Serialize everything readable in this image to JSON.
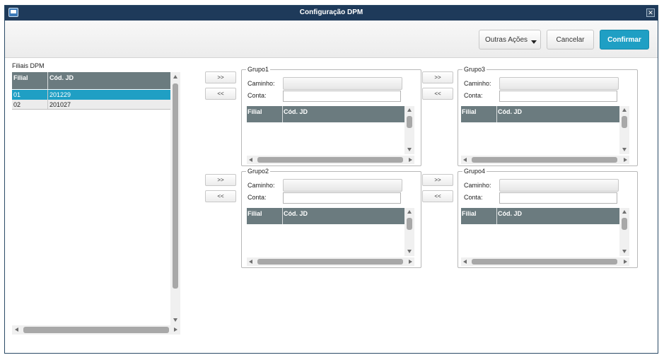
{
  "window": {
    "title": "Configuração DPM"
  },
  "toolbar": {
    "other_actions_label": "Outras Ações",
    "cancel_label": "Cancelar",
    "confirm_label": "Confirmar"
  },
  "filiais": {
    "label": "Filiais DPM",
    "columns": [
      "Filial",
      "Cód. JD"
    ],
    "rows": [
      {
        "filial": "01",
        "cod": "201229",
        "selected": true
      },
      {
        "filial": "02",
        "cod": "201027",
        "selected": false
      }
    ]
  },
  "move": {
    "add_label": ">>",
    "remove_label": "<<"
  },
  "groups": [
    {
      "title": "Grupo1",
      "caminho_label": "Caminho:",
      "conta_label": "Conta:",
      "conta_value": "",
      "columns": [
        "Filial",
        "Cód. JD"
      ]
    },
    {
      "title": "Grupo2",
      "caminho_label": "Caminho:",
      "conta_label": "Conta:",
      "conta_value": "",
      "columns": [
        "Filial",
        "Cód. JD"
      ]
    },
    {
      "title": "Grupo3",
      "caminho_label": "Caminho:",
      "conta_label": "Conta:",
      "conta_value": "",
      "columns": [
        "Filial",
        "Cód. JD"
      ]
    },
    {
      "title": "Grupo4",
      "caminho_label": "Caminho:",
      "conta_label": "Conta:",
      "conta_value": "",
      "columns": [
        "Filial",
        "Cód. JD"
      ]
    }
  ],
  "colors": {
    "titlebar": "#1e3a5a",
    "primary": "#1f9fc4",
    "grid_header": "#6b7b7f"
  }
}
